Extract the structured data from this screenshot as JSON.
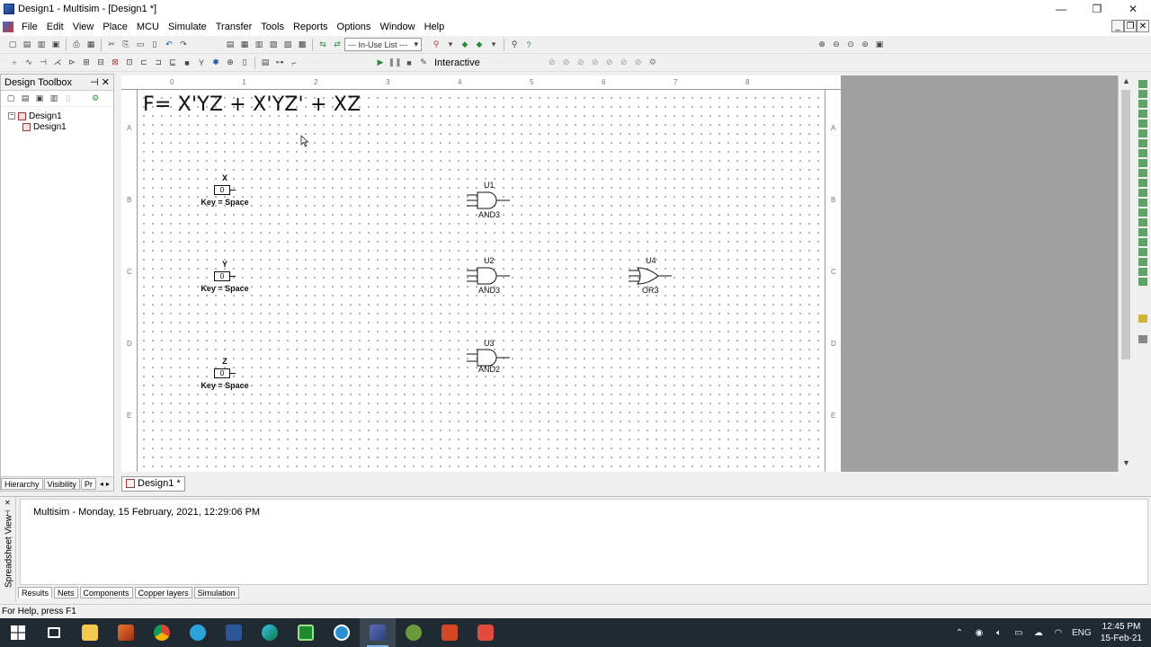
{
  "window": {
    "title": "Design1 - Multisim - [Design1 *]",
    "minimize": "—",
    "restore": "❐",
    "close": "✕"
  },
  "menu": [
    {
      "label": "File"
    },
    {
      "label": "Edit"
    },
    {
      "label": "View"
    },
    {
      "label": "Place"
    },
    {
      "label": "MCU"
    },
    {
      "label": "Simulate"
    },
    {
      "label": "Transfer"
    },
    {
      "label": "Tools"
    },
    {
      "label": "Reports"
    },
    {
      "label": "Options"
    },
    {
      "label": "Window"
    },
    {
      "label": "Help"
    }
  ],
  "toolbar": {
    "in_use_list": "--- In-Use List ---",
    "interactive": "Interactive"
  },
  "toolbox": {
    "title": "Design Toolbox",
    "tree_root": "Design1",
    "tree_child": "Design1",
    "tabs": [
      "Hierarchy",
      "Visibility",
      "Pr"
    ]
  },
  "schematic": {
    "formula": "F= X'YZ + X'YZ' + XZ",
    "ruler_top": [
      "0",
      "1",
      "2",
      "3",
      "4",
      "5",
      "6",
      "7",
      "8"
    ],
    "ruler_side": [
      "A",
      "B",
      "C",
      "D",
      "E"
    ],
    "switches": [
      {
        "name": "X",
        "value": "0",
        "key": "Key = Space"
      },
      {
        "name": "Y",
        "value": "0",
        "key": "Key = Space"
      },
      {
        "name": "Z",
        "value": "0",
        "key": "Key = Space"
      }
    ],
    "gates": [
      {
        "ref": "U1",
        "type": "AND3"
      },
      {
        "ref": "U2",
        "type": "AND3"
      },
      {
        "ref": "U3",
        "type": "AND2"
      },
      {
        "ref": "U4",
        "type": "OR3"
      }
    ]
  },
  "doc_tab": "Design1 *",
  "spreadsheet": {
    "side_label": "Spreadsheet View",
    "log_line": "Multisim  -  Monday, 15 February, 2021, 12:29:06 PM",
    "tabs": [
      "Results",
      "Nets",
      "Components",
      "Copper layers",
      "Simulation"
    ]
  },
  "status": {
    "help_text": "For Help, press F1"
  },
  "taskbar": {
    "language": "ENG",
    "time": "12:45 PM",
    "date": "15-Feb-21"
  }
}
